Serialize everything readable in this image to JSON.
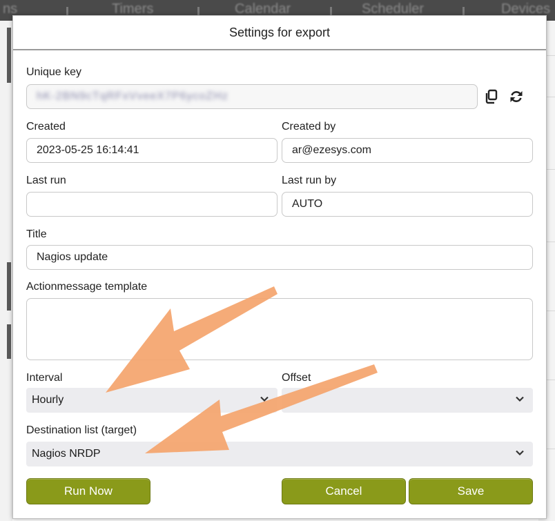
{
  "background": {
    "tabs": [
      "ns",
      "Timers",
      "Calendar",
      "Scheduler",
      "Devices"
    ]
  },
  "dialog": {
    "title": "Settings for export",
    "unique_key": {
      "label": "Unique key",
      "value": "hK-2BN9cTqRFxVveeX7P6ycoZHz"
    },
    "created": {
      "label": "Created",
      "value": "2023-05-25 16:14:41"
    },
    "created_by": {
      "label": "Created by",
      "value": "ar@ezesys.com"
    },
    "last_run": {
      "label": "Last run",
      "value": ""
    },
    "last_run_by": {
      "label": "Last run by",
      "value": "AUTO"
    },
    "title_field": {
      "label": "Title",
      "value": "Nagios update"
    },
    "action_template": {
      "label": "Actionmessage template",
      "value": ""
    },
    "interval": {
      "label": "Interval",
      "value": "Hourly"
    },
    "offset": {
      "label": "Offset",
      "value": ""
    },
    "destination": {
      "label": "Destination list (target)",
      "value": "Nagios NRDP"
    },
    "buttons": {
      "run_now": "Run Now",
      "cancel": "Cancel",
      "save": "Save"
    }
  },
  "colors": {
    "button_green": "#8a9a1a",
    "arrow_orange": "#f4a46c"
  },
  "icons": [
    "copy-icon",
    "refresh-icon",
    "chevron-down-icon"
  ]
}
